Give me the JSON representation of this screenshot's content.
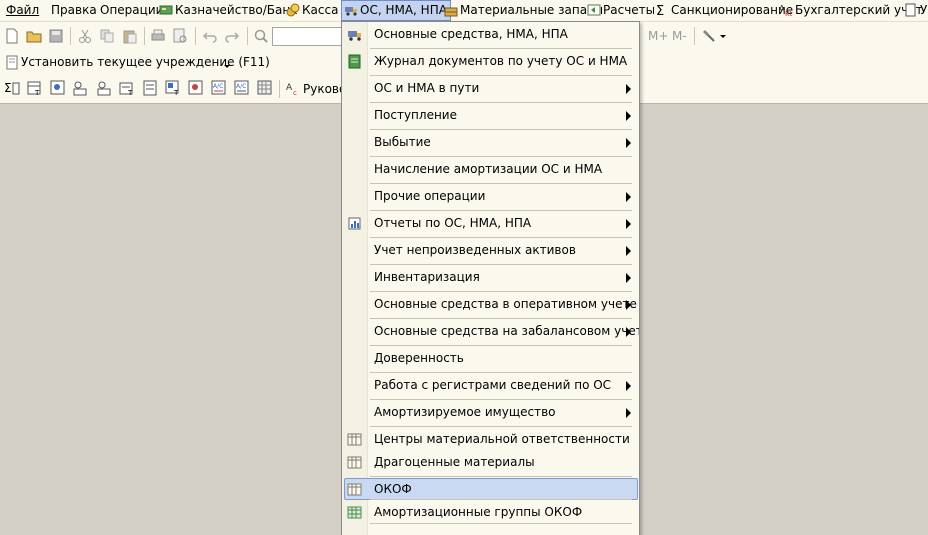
{
  "menubar": {
    "file": "Файл",
    "edit": "Правка",
    "operations": "Операции",
    "treasury": "Казначейство/Банк",
    "cash": "Касса",
    "fixed_assets": "ОС, НМА, НПА",
    "materials": "Материальные запасы",
    "settlements": "Расчеты",
    "sanctioning": "Санкционирование",
    "accounting": "Бухгалтерский учет",
    "next_partial": "У"
  },
  "toolbar1": {
    "m_plus": "M+",
    "m_minus": "M-"
  },
  "toolbar2": {
    "set_institution": "Установить текущее учреждение (F11)"
  },
  "toolbar3": {
    "manager_partial": "Руково"
  },
  "dropdown": {
    "items": [
      {
        "label": "Основные средства, НМА, НПА",
        "submenu": false,
        "icon": "truck-icon"
      },
      {
        "label": "Журнал документов по учету ОС и НМА",
        "submenu": false,
        "icon": "journal-icon"
      },
      {
        "label": "ОС и НМА в пути",
        "submenu": true,
        "icon": ""
      },
      {
        "label": "Поступление",
        "submenu": true,
        "icon": ""
      },
      {
        "label": "Выбытие",
        "submenu": true,
        "icon": ""
      },
      {
        "label": "Начисление амортизации ОС и НМА",
        "submenu": false,
        "icon": ""
      },
      {
        "label": "Прочие операции",
        "submenu": true,
        "icon": ""
      },
      {
        "label": "Отчеты по ОС, НМА, НПА",
        "submenu": true,
        "icon": "report-icon"
      },
      {
        "label": "Учет непроизведенных активов",
        "submenu": true,
        "icon": ""
      },
      {
        "label": "Инвентаризация",
        "submenu": true,
        "icon": ""
      },
      {
        "label": "Основные средства в оперативном учете",
        "submenu": true,
        "icon": ""
      },
      {
        "label": "Основные средства на забалансовом учете",
        "submenu": true,
        "icon": ""
      },
      {
        "label": "Доверенность",
        "submenu": false,
        "icon": ""
      },
      {
        "label": "Работа с регистрами сведений по ОС",
        "submenu": true,
        "icon": ""
      },
      {
        "label": "Амортизируемое имущество",
        "submenu": true,
        "icon": ""
      },
      {
        "label": "Центры материальной ответственности",
        "submenu": false,
        "icon": "table-icon"
      },
      {
        "label": "Драгоценные материалы",
        "submenu": false,
        "icon": "table-icon"
      },
      {
        "label": "ОКОФ",
        "submenu": false,
        "icon": "table-icon",
        "highlighted": true
      },
      {
        "label": "Амортизационные группы ОКОФ",
        "submenu": false,
        "icon": "grid-icon"
      }
    ]
  },
  "colors": {
    "menu_bg": "#fbf9ee",
    "workspace": "#d4d0c8",
    "highlight": "#c9d9f2",
    "highlight_border": "#7e9ad0"
  }
}
